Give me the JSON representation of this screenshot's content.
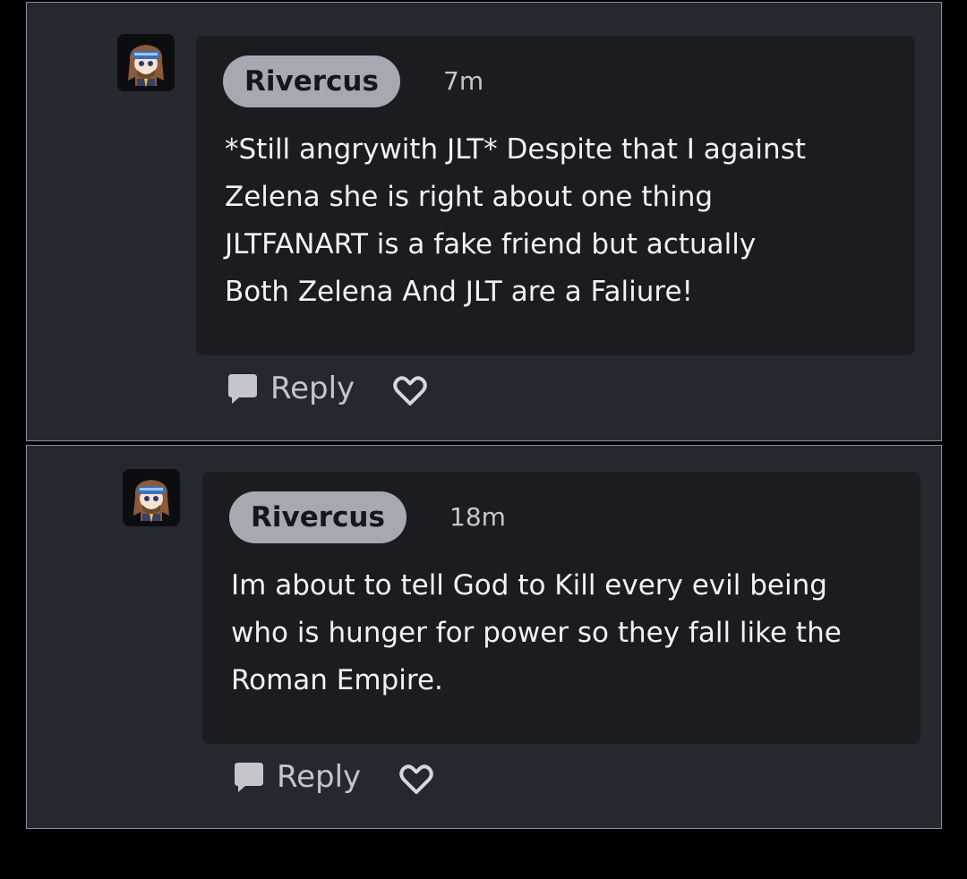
{
  "comments": [
    {
      "username": "Rivercus",
      "time": "7m",
      "text": "*Still angrywith JLT* Despite that I against\nZelena she is right about one thing\nJLTFANART is a fake friend but actually\nBoth Zelena And JLT are a Faliure!",
      "reply_label": "Reply"
    },
    {
      "username": "Rivercus",
      "time": "18m",
      "text": "Im about to tell God to Kill every evil being\nwho is hunger for power so they fall like the\nRoman Empire.",
      "reply_label": "Reply"
    }
  ],
  "icons": {
    "avatar": "user-avatar-knight",
    "reply": "speech-bubble-icon",
    "like": "heart-icon"
  },
  "colors": {
    "page_background": "#000000",
    "panel_background": "#26282f",
    "bubble_background": "#1b1c20",
    "name_pill": "#a7a9b2",
    "text": "#f2f2f4",
    "muted_text": "#c4c6cc"
  }
}
